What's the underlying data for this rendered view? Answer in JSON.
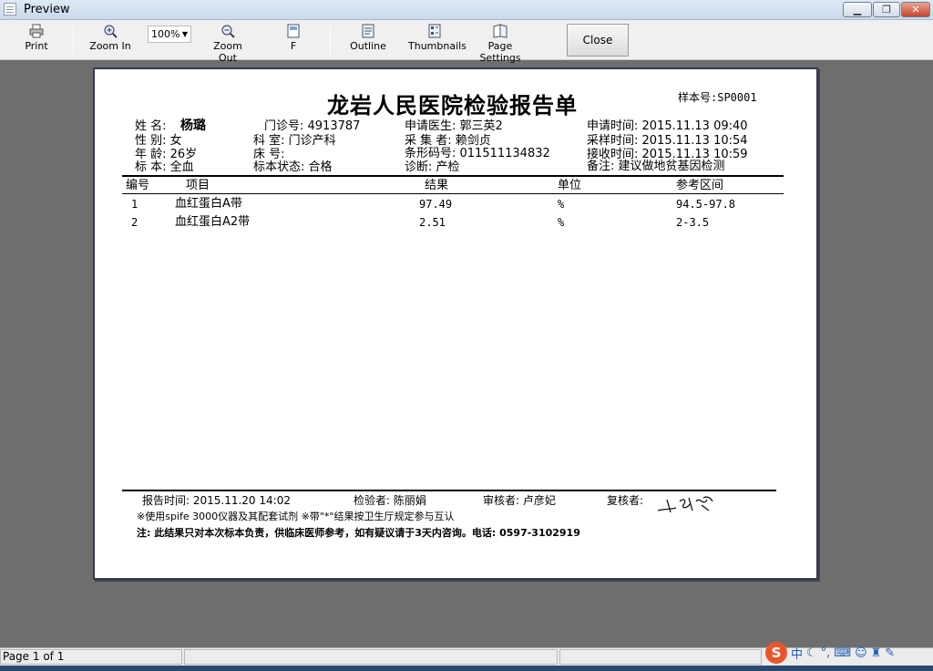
{
  "window": {
    "title": "Preview"
  },
  "toolbar": {
    "print": "Print",
    "zoom_in": "Zoom In",
    "zoom_value": "100%",
    "zoom_out": "Zoom Out",
    "f": "F",
    "outline": "Outline",
    "thumbnails": "Thumbnails",
    "page_settings": "Page Settings",
    "close": "Close"
  },
  "report": {
    "title": "龙岩人民医院检验报告单",
    "sample_no": "样本号:SP0001",
    "fields": {
      "name_label": "姓 名:",
      "name": "杨璐",
      "outpatient_no": "门诊号: 4913787",
      "doctor": "申请医生: 郭三英2",
      "apply_time": "申请时间: 2015.11.13 09:40",
      "sex": "性 别: 女",
      "dept": "科      室: 门诊产科",
      "collector": "采 集 者: 赖剑贞",
      "sample_time": "采样时间: 2015.11.13 10:54",
      "age": "年 龄: 26岁",
      "bed": "床      号:",
      "barcode": "条形码号: 011511134832",
      "receive_time": "接收时间: 2015.11.13 10:59",
      "specimen": "标 本: 全血",
      "specimen_status": "标本状态: 合格",
      "diagnosis": "诊断: 产检",
      "remark": "备注: 建议做地贫基因检测"
    },
    "columns": [
      "编号",
      "项目",
      "结果",
      "单位",
      "参考区间"
    ],
    "rows": [
      [
        "1",
        "血红蛋白A带",
        "97.49",
        "%",
        "94.5-97.8"
      ],
      [
        "2",
        "血红蛋白A2带",
        "2.51",
        "%",
        "2-3.5"
      ]
    ],
    "footer": {
      "report_time": "报告时间: 2015.11.20 14:02",
      "tester": "检验者: 陈丽娟",
      "reviewer": "审核者: 卢彦妃",
      "rechecker": "复核者:",
      "note1": "※使用spife 3000仪器及其配套试剂  ※带\"*\"结果按卫生厅规定参与互认",
      "note2": "注: 此结果只对本次标本负责，供临床医师参考，如有疑议请于3天内咨询。电话: 0597-3102919"
    }
  },
  "status": {
    "page": "Page 1 of 1"
  },
  "ime": {
    "lang": "中"
  }
}
